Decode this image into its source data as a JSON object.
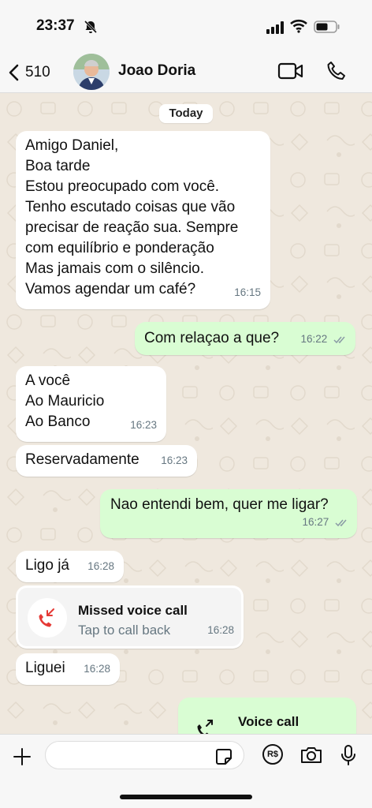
{
  "status_bar": {
    "time": "23:37"
  },
  "header": {
    "back_count": "510",
    "contact_name": "Joao Doria"
  },
  "chat": {
    "date_label": "Today",
    "messages": [
      {
        "dir": "in",
        "text": "Amigo Daniel,\nBoa tarde\nEstou preocupado com você.\nTenho escutado coisas que vão\nprecisar de reação sua. Sempre\ncom equilíbrio e ponderação\nMas jamais com o silêncio.\nVamos agendar um café?",
        "time": "16:15"
      },
      {
        "dir": "out",
        "text": "Com relaçao a que?",
        "time": "16:22",
        "status": "read"
      },
      {
        "dir": "in",
        "text": "A você\nAo Mauricio\nAo Banco",
        "time": "16:23"
      },
      {
        "dir": "in",
        "text": "Reservadamente",
        "time": "16:23"
      },
      {
        "dir": "out",
        "text": "Nao entendi bem, quer me ligar?",
        "time": "16:27",
        "status": "read"
      },
      {
        "dir": "in",
        "text": "Ligo já",
        "time": "16:28"
      },
      {
        "dir": "in",
        "type": "missed_call",
        "title": "Missed voice call",
        "subtitle": "Tap to call back",
        "time": "16:28",
        "icon": "missed-call-icon"
      },
      {
        "dir": "in",
        "text": "Liguei",
        "time": "16:28"
      },
      {
        "dir": "out",
        "type": "voice_call",
        "title": "Voice call",
        "icon": "outgoing-call-icon"
      }
    ]
  },
  "input_bar": {
    "placeholder": ""
  },
  "colors": {
    "incoming": "#ffffff",
    "outgoing": "#d9fdd3",
    "read_tick": "#53bdeb",
    "missed": "#e53935",
    "background": "#efe8de"
  }
}
